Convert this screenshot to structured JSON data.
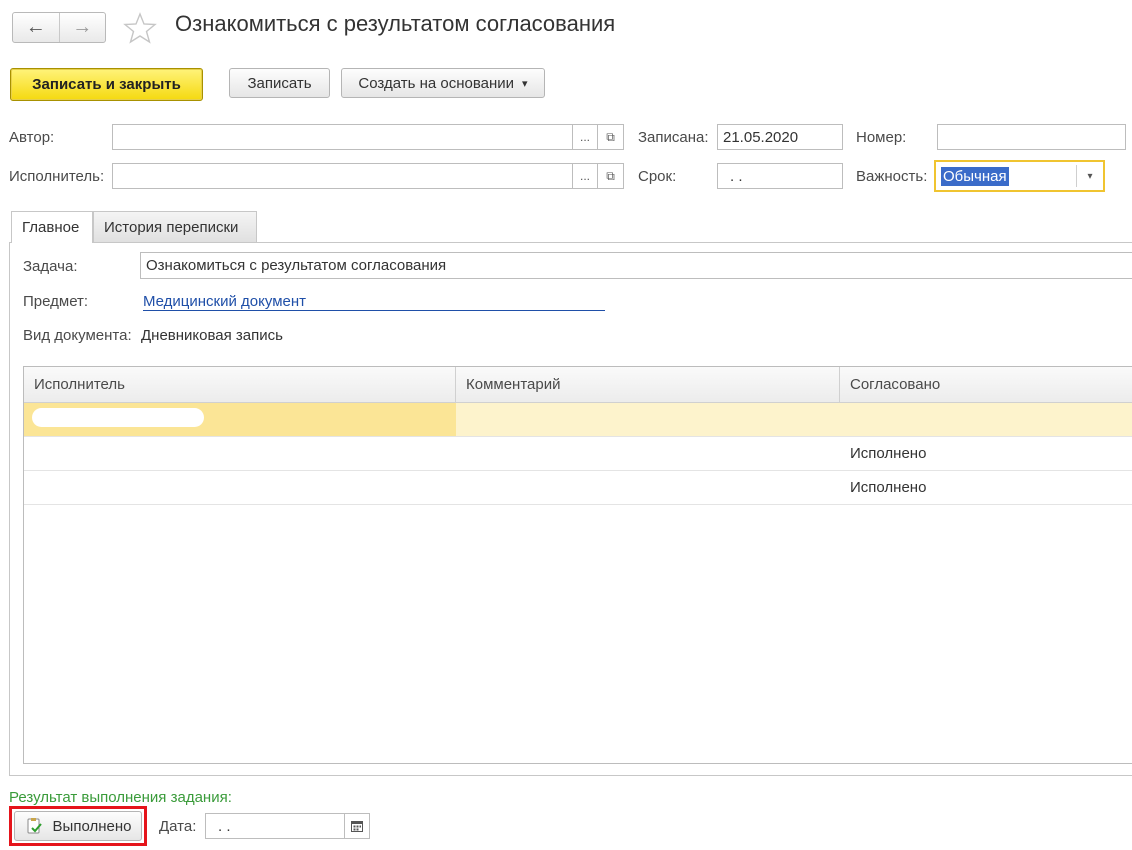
{
  "window": {
    "title": "Ознакомиться с результатом согласования"
  },
  "nav": {
    "back_icon": "←",
    "forward_icon": "→"
  },
  "toolbar": {
    "save_close_label": "Записать и закрыть",
    "save_label": "Записать",
    "create_based_label": "Создать на основании",
    "dropdown_arrow": "▾"
  },
  "header": {
    "author_label": "Автор:",
    "author_value": "",
    "executor_label": "Исполнитель:",
    "executor_value": "",
    "recorded_label": "Записана:",
    "recorded_value": "21.05.2020",
    "number_label": "Номер:",
    "number_value": "",
    "deadline_label": "Срок:",
    "deadline_value": ". .",
    "importance_label": "Важность:",
    "importance_value": "Обычная",
    "select_button": "...",
    "open_icon": "⧉"
  },
  "tabs": [
    {
      "label": "Главное"
    },
    {
      "label": "История переписки"
    }
  ],
  "main": {
    "task_label": "Задача:",
    "task_value": "Ознакомиться с результатом согласования",
    "subject_label": "Предмет:",
    "subject_value": "Медицинский документ",
    "doctype_label": "Вид документа:",
    "doctype_value": "Дневниковая запись"
  },
  "table": {
    "columns": [
      "Исполнитель",
      "Комментарий",
      "Согласовано"
    ],
    "rows": [
      {
        "executor": "",
        "comment": "",
        "agreed": ""
      },
      {
        "executor": "",
        "comment": "",
        "agreed": "Исполнено"
      },
      {
        "executor": "",
        "comment": "",
        "agreed": "Исполнено"
      }
    ]
  },
  "footer": {
    "result_label": "Результат выполнения задания:",
    "done_button": "Выполнено",
    "date_label": "Дата:",
    "date_value": ". .",
    "calendar_icon": "calendar-icon"
  },
  "colors": {
    "primary_button": "#f5d90f",
    "selected_row": "#fbe596",
    "highlight_row": "#fdf3cc",
    "link": "#1f4fa8",
    "result_label": "#3a9b3a",
    "focus_border": "#f0c430",
    "red_frame": "#e5141b"
  }
}
